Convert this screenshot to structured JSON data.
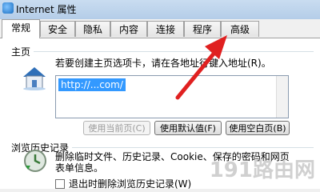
{
  "window": {
    "title": "Internet 属性"
  },
  "tabs": [
    {
      "label": "常规"
    },
    {
      "label": "安全"
    },
    {
      "label": "隐私"
    },
    {
      "label": "内容"
    },
    {
      "label": "连接"
    },
    {
      "label": "程序"
    },
    {
      "label": "高级"
    }
  ],
  "home": {
    "group_label": "主页",
    "description": "若要创建主页选项卡，请在各地址行键入地址(R)。",
    "url_value": "http://...com/",
    "buttons": {
      "use_current": "使用当前页(C)",
      "use_default": "使用默认值(F)",
      "use_blank": "使用空白页(B)"
    }
  },
  "history": {
    "group_label": "浏览历史记录",
    "description_line1": "删除临时文件、历史记录、Cookie、保存的密码和网页",
    "description_line2": "表单信息。",
    "checkbox_label": "退出时删除浏览历史记录(W)"
  },
  "watermark": "191路由网",
  "colors": {
    "selection": "#3399ff",
    "annotation_arrow": "#e02020"
  },
  "icons": [
    "house-icon",
    "history-icon",
    "app-icon"
  ]
}
